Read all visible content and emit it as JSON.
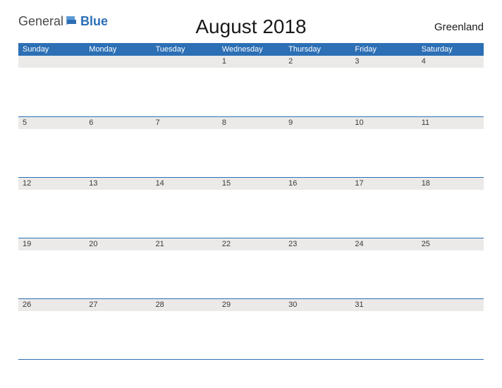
{
  "logo": {
    "part1": "General",
    "part2": "Blue"
  },
  "title": "August 2018",
  "region": "Greenland",
  "day_headers": [
    "Sunday",
    "Monday",
    "Tuesday",
    "Wednesday",
    "Thursday",
    "Friday",
    "Saturday"
  ],
  "weeks": [
    [
      "",
      "",
      "",
      "1",
      "2",
      "3",
      "4"
    ],
    [
      "5",
      "6",
      "7",
      "8",
      "9",
      "10",
      "11"
    ],
    [
      "12",
      "13",
      "14",
      "15",
      "16",
      "17",
      "18"
    ],
    [
      "19",
      "20",
      "21",
      "22",
      "23",
      "24",
      "25"
    ],
    [
      "26",
      "27",
      "28",
      "29",
      "30",
      "31",
      ""
    ]
  ]
}
